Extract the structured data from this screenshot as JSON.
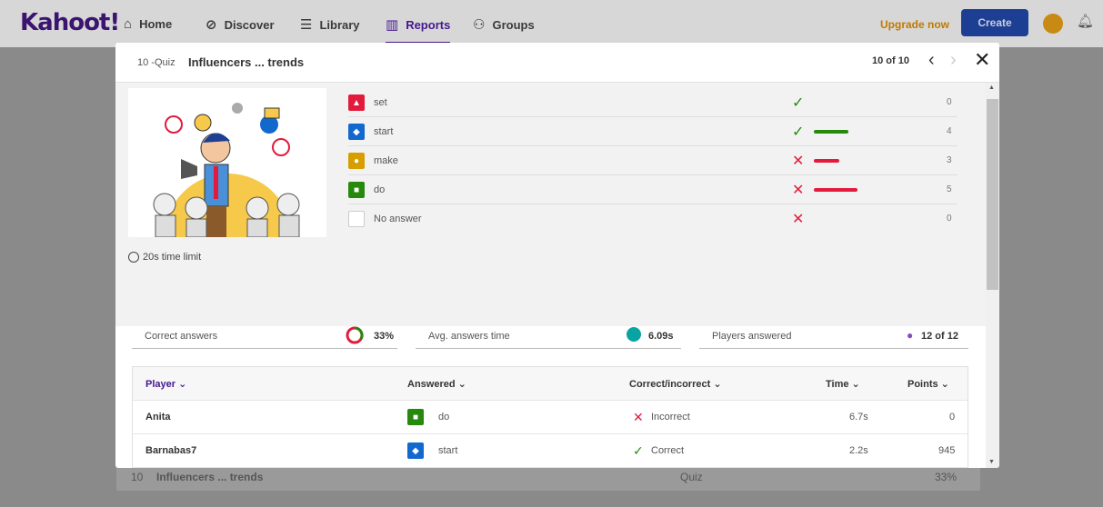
{
  "nav": {
    "logo": "Kahoot!",
    "items": [
      {
        "label": "Home",
        "icon": "home-icon",
        "glyph": "⌂"
      },
      {
        "label": "Discover",
        "icon": "compass-icon",
        "glyph": "⊘"
      },
      {
        "label": "Library",
        "icon": "list-icon",
        "glyph": "☰"
      },
      {
        "label": "Reports",
        "icon": "bar-chart-icon",
        "glyph": "▥"
      },
      {
        "label": "Groups",
        "icon": "people-icon",
        "glyph": "⚇"
      }
    ],
    "upgrade_label": "Upgrade now",
    "create_label": "Create"
  },
  "background": {
    "row_number": "10",
    "row_title": "Influencers ... trends",
    "row_type": "Quiz",
    "row_percent": "33%"
  },
  "modal": {
    "question_type": "10 -Quiz",
    "question_title": "Influencers ... trends",
    "counter": "10 of 10",
    "time_limit": "20s time limit",
    "answers": [
      {
        "label": "set",
        "shape": "triangle",
        "color": "#e21b3c",
        "correct": true,
        "count": "0",
        "bar_fraction": 0,
        "bar_color": "#26890c"
      },
      {
        "label": "start",
        "shape": "diamond",
        "color": "#1368ce",
        "correct": true,
        "count": "4",
        "bar_fraction": 0.8,
        "bar_color": "#26890c"
      },
      {
        "label": "make",
        "shape": "circle",
        "color": "#d89e00",
        "correct": false,
        "count": "3",
        "bar_fraction": 0.6,
        "bar_color": "#e21b3c"
      },
      {
        "label": "do",
        "shape": "square",
        "color": "#26890c",
        "correct": false,
        "count": "5",
        "bar_fraction": 1.0,
        "bar_color": "#e21b3c"
      },
      {
        "label": "No answer",
        "shape": "none",
        "color": "#ffffff",
        "correct": false,
        "count": "0",
        "bar_fraction": 0,
        "bar_color": "#e21b3c"
      }
    ],
    "stats": {
      "correct_label": "Correct answers",
      "correct_value": "33%",
      "correct_fraction": 0.33,
      "time_label": "Avg. answers time",
      "time_value": "6.09s",
      "players_label": "Players answered",
      "players_value": "12 of 12"
    },
    "table": {
      "headers": {
        "player": "Player",
        "answered": "Answered",
        "correct": "Correct/incorrect",
        "time": "Time",
        "points": "Points"
      },
      "rows": [
        {
          "player": "Anita",
          "answer": "do",
          "shape": "square",
          "color": "#26890c",
          "result": "Incorrect",
          "result_mark": "✕",
          "result_color": "#e21b3c",
          "time": "6.7s",
          "points": "0"
        },
        {
          "player": "Barnabas7",
          "answer": "start",
          "shape": "diamond",
          "color": "#1368ce",
          "result": "Correct",
          "result_mark": "✓",
          "result_color": "#26890c",
          "time": "2.2s",
          "points": "945"
        }
      ]
    }
  }
}
